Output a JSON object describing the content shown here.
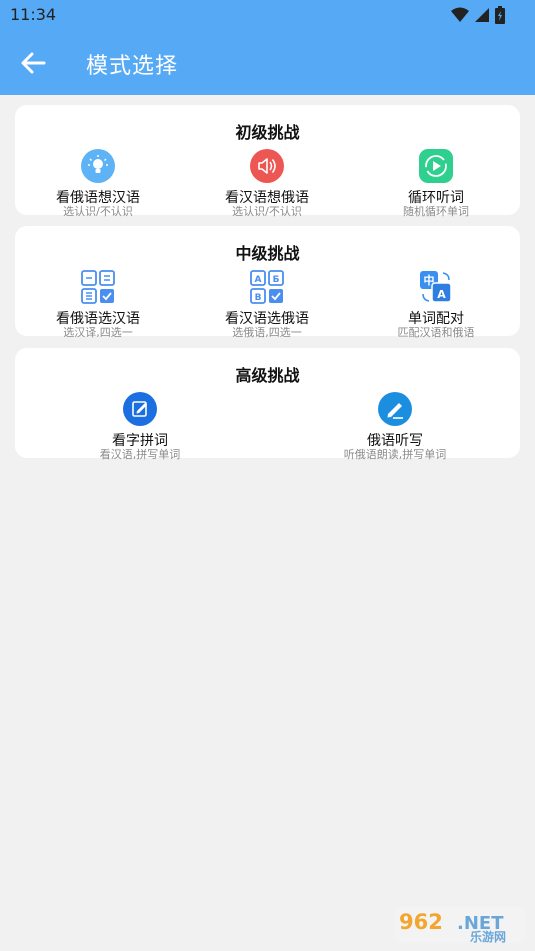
{
  "status": {
    "time": "11:34"
  },
  "appbar": {
    "title": "模式选择"
  },
  "cards": [
    {
      "heading": "初级挑战",
      "items": [
        {
          "label": "看俄语想汉语",
          "sub": "选认识/不认识",
          "icon": "lightbulb-icon",
          "color": "#5db3f5"
        },
        {
          "label": "看汉语想俄语",
          "sub": "选认识/不认识",
          "icon": "speaker-icon",
          "color": "#ec5653"
        },
        {
          "label": "循环听词",
          "sub": "随机循环单词",
          "icon": "loop-play-icon",
          "color": "#2fd08f"
        }
      ]
    },
    {
      "heading": "中级挑战",
      "items": [
        {
          "label": "看俄语选汉语",
          "sub": "选汉译,四选一",
          "icon": "grid-choice-icon",
          "color": "#4a8ef0"
        },
        {
          "label": "看汉语选俄语",
          "sub": "选俄语,四选一",
          "icon": "cyrillic-grid-icon",
          "color": "#4a8ef0",
          "letters": [
            "A",
            "Б",
            "B",
            "✓"
          ]
        },
        {
          "label": "单词配对",
          "sub": "匹配汉语和俄语",
          "icon": "translate-icon",
          "color": "#3b8ff0",
          "letters": [
            "中",
            "A"
          ]
        }
      ]
    },
    {
      "heading": "高级挑战",
      "items": [
        {
          "label": "看字拼词",
          "sub": "看汉语,拼写单词",
          "icon": "edit-icon",
          "color": "#1c6fe0"
        },
        {
          "label": "俄语听写",
          "sub": "听俄语朗读,拼写单词",
          "icon": "pen-icon",
          "color": "#1c8ee0"
        }
      ]
    }
  ],
  "watermark": {
    "text1": "962",
    "text2": ".NET",
    "text3": "乐游网"
  }
}
